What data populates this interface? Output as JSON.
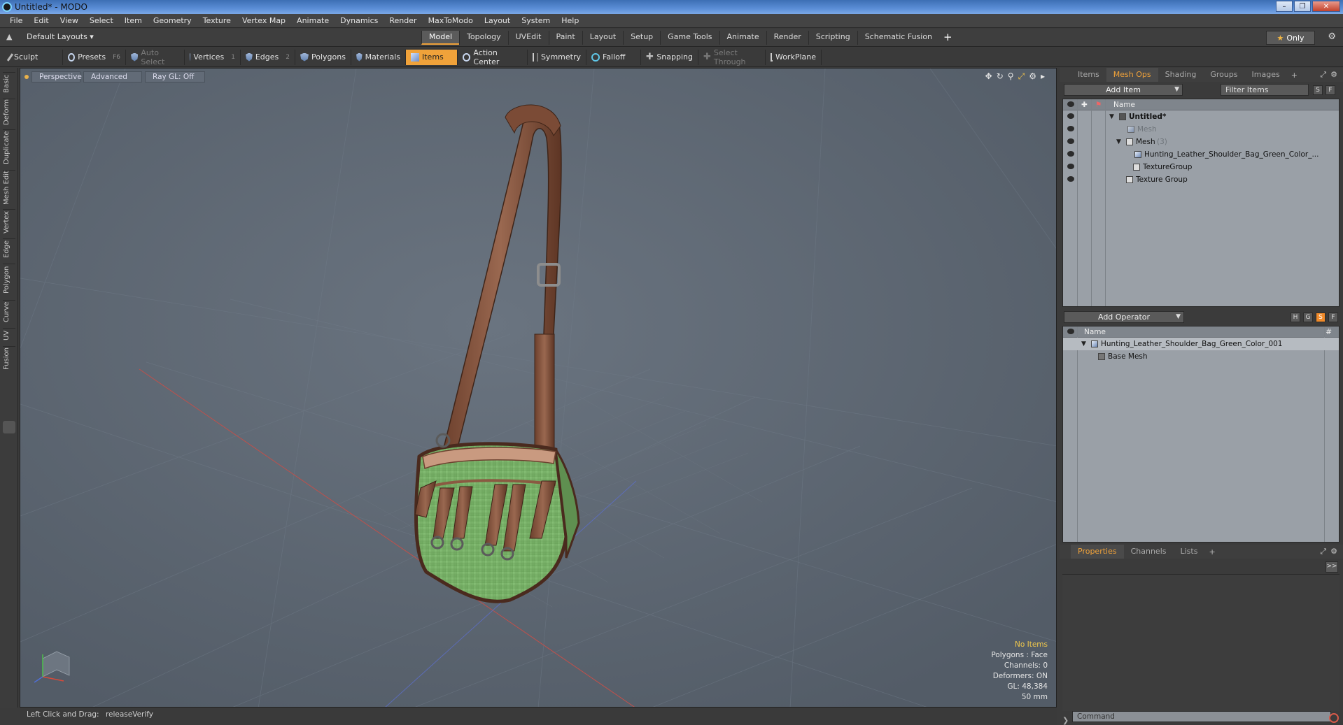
{
  "window": {
    "title": "Untitled* - MODO"
  },
  "menu": [
    "File",
    "Edit",
    "View",
    "Select",
    "Item",
    "Geometry",
    "Texture",
    "Vertex Map",
    "Animate",
    "Dynamics",
    "Render",
    "MaxToModo",
    "Layout",
    "System",
    "Help"
  ],
  "layoutbar": {
    "layout_name": "Default Layouts ▾",
    "tabs": [
      "Model",
      "Topology",
      "UVEdit",
      "Paint",
      "Layout",
      "Setup",
      "Game Tools",
      "Animate",
      "Render",
      "Scripting",
      "Schematic Fusion"
    ],
    "active_tab": "Model",
    "add": "+",
    "only_label": "Only"
  },
  "toolbar": {
    "sculpt": "Sculpt",
    "presets": "Presets",
    "presets_key": "F6",
    "auto_select": "Auto Select",
    "vertices": "Vertices",
    "vertices_key": "1",
    "edges": "Edges",
    "edges_key": "2",
    "polygons": "Polygons",
    "materials": "Materials",
    "items": "Items",
    "action_center": "Action Center",
    "symmetry": "Symmetry",
    "falloff": "Falloff",
    "snapping": "Snapping",
    "select_through": "Select Through",
    "workplane": "WorkPlane"
  },
  "left_tabs": [
    "Basic",
    "Deform",
    "Duplicate",
    "Mesh Edit",
    "Vertex",
    "Edge",
    "Polygon",
    "Curve",
    "UV",
    "Fusion"
  ],
  "viewport": {
    "view": "Perspective",
    "shading": "Advanced",
    "raygl": "Ray GL: Off",
    "info": {
      "no_items": "No Items",
      "polygons": "Polygons : Face",
      "channels": "Channels: 0",
      "deformers": "Deformers: ON",
      "gl": "GL: 48,384",
      "scale": "50 mm"
    }
  },
  "status": {
    "hint": "Left Click and Drag:",
    "action": "releaseVerify"
  },
  "items_panel": {
    "tabs": [
      "Items",
      "Mesh Ops",
      "Shading",
      "Groups",
      "Images"
    ],
    "active_tab": "Mesh Ops",
    "add_item": "Add Item",
    "filter": "Filter Items",
    "btn_s": "S",
    "btn_f": "F",
    "col_name": "Name",
    "rows": [
      {
        "label": "Untitled*"
      },
      {
        "label": "Mesh"
      },
      {
        "label": "Mesh",
        "count": "(3)"
      },
      {
        "label": "Hunting_Leather_Shoulder_Bag_Green_Color_..."
      },
      {
        "label": "TextureGroup"
      },
      {
        "label": "Texture Group"
      }
    ]
  },
  "operator_panel": {
    "add_operator": "Add Operator",
    "btn_h": "H",
    "btn_g": "G",
    "btn_s": "S",
    "btn_f": "F",
    "col_name": "Name",
    "col_hash": "#",
    "rows": [
      {
        "label": "Hunting_Leather_Shoulder_Bag_Green_Color_001"
      },
      {
        "label": "Base Mesh"
      }
    ]
  },
  "props_panel": {
    "tabs": [
      "Properties",
      "Channels",
      "Lists"
    ],
    "active_tab": "Properties",
    "expand": ">>",
    "command_placeholder": "Command"
  },
  "colors": {
    "accent": "#f0a23a",
    "viewport_bg": "#5b6571",
    "bag_green": "#7fb36a",
    "leather": "#7a4a35"
  }
}
